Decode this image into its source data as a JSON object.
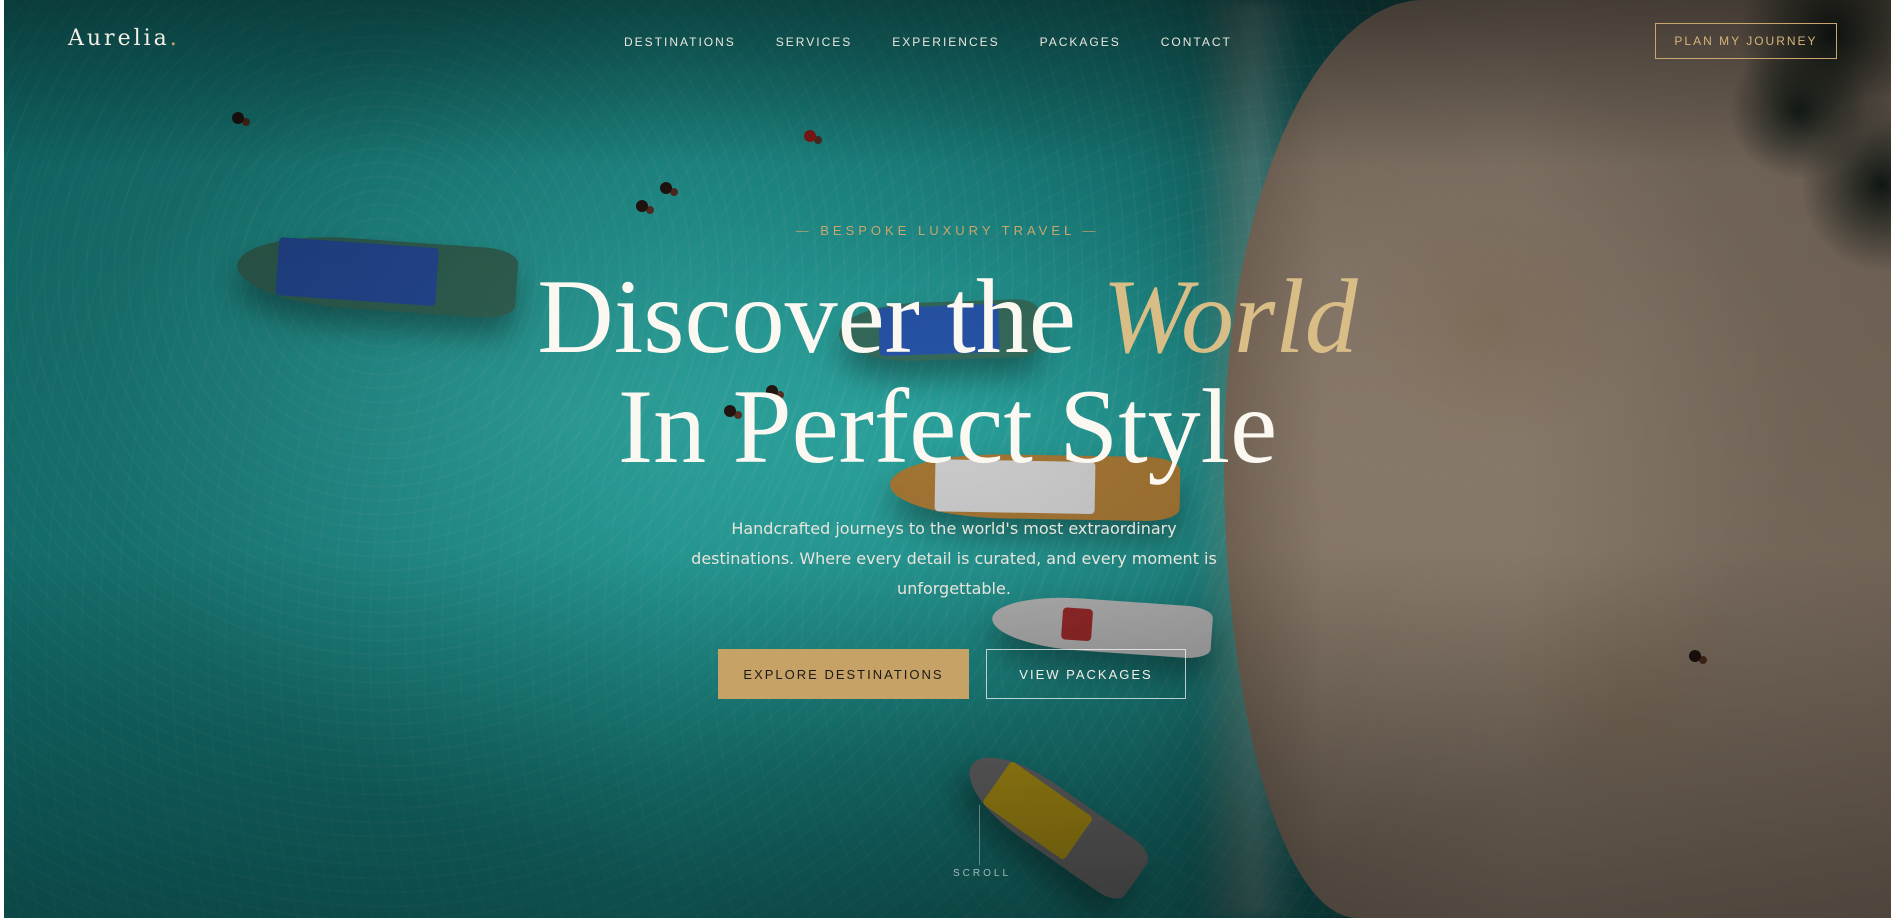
{
  "nav": {
    "logo": "Aurelia",
    "logo_dot": ".",
    "items": [
      {
        "label": "DESTINATIONS"
      },
      {
        "label": "SERVICES"
      },
      {
        "label": "EXPERIENCES"
      },
      {
        "label": "PACKAGES"
      },
      {
        "label": "CONTACT"
      }
    ],
    "cta_label": "PLAN MY JOURNEY"
  },
  "hero": {
    "eyebrow_dash_left": "—",
    "eyebrow": "BESPOKE LUXURY TRAVEL",
    "eyebrow_dash_right": "—",
    "headline_part1": "Discover the ",
    "headline_accent": "World",
    "headline_line2": "In Perfect Style",
    "subtitle": "Handcrafted journeys to the world's most extraordinary destinations. Where every detail is curated, and every moment is unforgettable.",
    "primary_cta": "EXPLORE DESTINATIONS",
    "secondary_cta": "VIEW PACKAGES",
    "scroll_label": "SCROLL"
  },
  "colors": {
    "gold_accent": "#c6a267",
    "text_light": "#fbf8f2",
    "water": "#1aa8a6",
    "sand": "#b8a18c"
  }
}
